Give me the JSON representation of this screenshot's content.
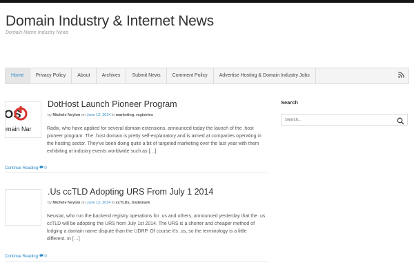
{
  "site": {
    "title": "Domain Industry & Internet News",
    "description": "Domain Name Industry News"
  },
  "nav": {
    "items": [
      {
        "label": "Home",
        "active": true
      },
      {
        "label": "Privacy Policy"
      },
      {
        "label": "About"
      },
      {
        "label": "Archives"
      },
      {
        "label": "Submit News"
      },
      {
        "label": "Comment Policy"
      },
      {
        "label": "Advertise Hosting & Domain Industry Jobs"
      }
    ],
    "rss_icon": "rss-icon"
  },
  "posts": [
    {
      "title": "DotHost Launch Pioneer Program",
      "meta": {
        "by": "by",
        "author": "Michele Neylon",
        "on": "on",
        "date": "June 12, 2014",
        "in": "in",
        "categories": "marketing, registries"
      },
      "thumb_text": "OS / omain Nar",
      "excerpt": "Radix, who have applied for several domain extensions, announced today the launch of the .host pioneer program. The .host domain is pretty self-explanatory and is aimed at companies operating in the hosting sector. They've been doing quite a bit of targeted marketing over the last year with them exhibiting at industry events worldwide such as […]",
      "read_more": "Continue Reading",
      "comments": "0"
    },
    {
      "title": ".Us ccTLD Adopting URS From July 1 2014",
      "meta": {
        "by": "by",
        "author": "Michele Neylon",
        "on": "on",
        "date": "June 12, 2014",
        "in": "in",
        "categories": "ccTLDs, trademark"
      },
      "excerpt": "Neustar, who run the backend registry operations for .us and others, announced yesterday that the .us ccTLD will be adopting the URS from July 1st 2014. The URS  is a shorter and cheaper method of lodging a domain name dispute than the UDRP. Of course it's .us, so the terminology is a little different. In […]",
      "read_more": "Continue Reading",
      "comments": "0"
    }
  ],
  "sidebar": {
    "search_title": "Search",
    "search_placeholder": "Search...",
    "search_icon": "search-icon"
  },
  "colors": {
    "link": "#2a88c4",
    "topbar": "#151515",
    "nav_bg": "#f4f4f4"
  }
}
